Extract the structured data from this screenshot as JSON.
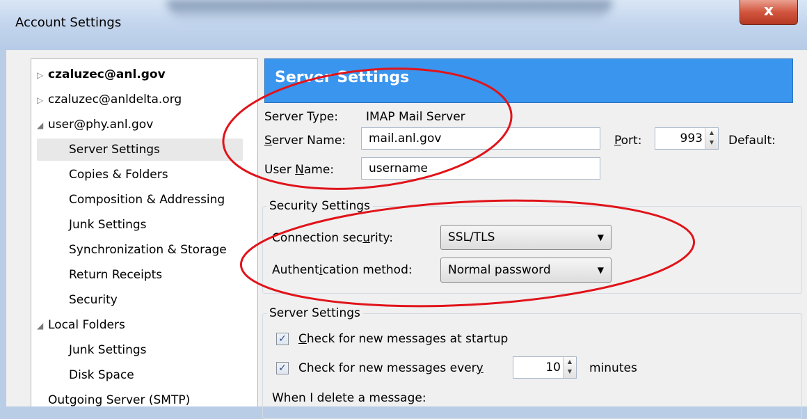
{
  "window": {
    "title": "Account Settings",
    "close_glyph": "x"
  },
  "tree": {
    "items": [
      {
        "label": "czaluzec@anl.gov",
        "arrow": "▷"
      },
      {
        "label": "czaluzec@anldelta.org",
        "arrow": "▷"
      },
      {
        "label": "user@phy.anl.gov",
        "arrow": "◢"
      },
      {
        "label": "Server Settings"
      },
      {
        "label": "Copies & Folders"
      },
      {
        "label": "Composition & Addressing"
      },
      {
        "label": "Junk Settings"
      },
      {
        "label": "Synchronization & Storage"
      },
      {
        "label": "Return Receipts"
      },
      {
        "label": "Security"
      },
      {
        "label": "Local Folders",
        "arrow": "◢"
      },
      {
        "label": "Junk Settings"
      },
      {
        "label": "Disk Space"
      },
      {
        "label": "Outgoing Server (SMTP)"
      }
    ]
  },
  "panel": {
    "header": "Server Settings",
    "server_type_label": "Server Type:",
    "server_type_value": "IMAP Mail Server",
    "server_name_label_ul": "S",
    "server_name_label_rest": "erver Name:",
    "server_name_value": "mail.anl.gov",
    "port_label_ul": "P",
    "port_label_rest": "ort:",
    "port_value": "993",
    "default_label": "Default:",
    "user_name_label_pre": "User ",
    "user_name_label_ul": "N",
    "user_name_label_rest": "ame:",
    "user_name_value": "username"
  },
  "security": {
    "legend": "Security Settings",
    "conn_label_pre": "Connection sec",
    "conn_label_ul": "u",
    "conn_label_rest": "rity:",
    "conn_value": "SSL/TLS",
    "auth_label_pre": "Authent",
    "auth_label_ul": "i",
    "auth_label_rest": "cation method:",
    "auth_value": "Normal password"
  },
  "server_settings": {
    "legend": "Server Settings",
    "check_startup_ul": "C",
    "check_startup_rest": "heck for new messages at startup",
    "check_every_pre": "Check for new messages ever",
    "check_every_ul": "y",
    "check_every_value": "10",
    "minutes_label": "minutes",
    "delete_label": "When I delete a message:"
  },
  "colors": {
    "header_blue": "#3a95ee",
    "annotation_red": "#e0141a"
  },
  "icons": {
    "checkbox": "checkmark-icon",
    "caret": "caret-down-icon",
    "spinner": "spinner-arrows-icon"
  }
}
